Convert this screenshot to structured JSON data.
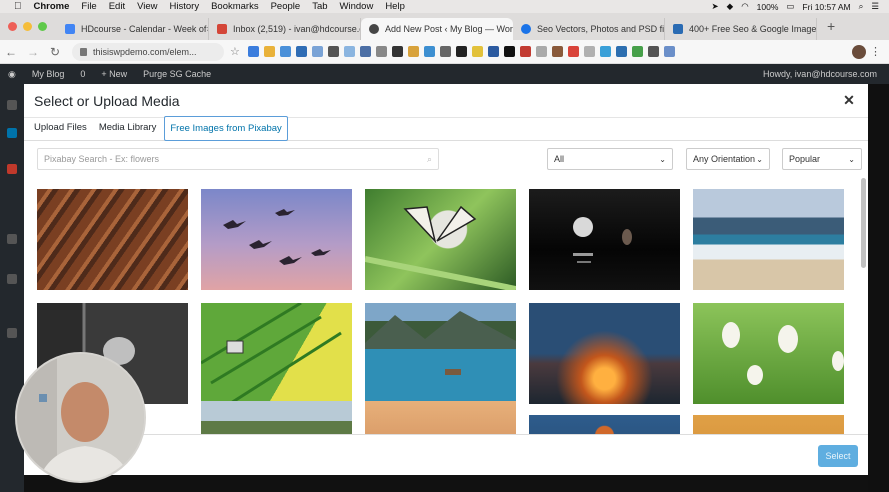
{
  "macbar": {
    "menus": [
      "Chrome",
      "File",
      "Edit",
      "View",
      "History",
      "Bookmarks",
      "People",
      "Tab",
      "Window",
      "Help"
    ],
    "battery": "100%",
    "clock": "Fri 10:57 AM"
  },
  "tabs": [
    {
      "title": "HDcourse - Calendar - Week of",
      "fav_color": "#4285f4",
      "active": false
    },
    {
      "title": "Inbox (2,519) - ivan@hdcourse.c",
      "fav_color": "#d44638",
      "active": false
    },
    {
      "title": "Add New Post ‹ My Blog — Wor",
      "fav_color": "#464646",
      "active": true
    },
    {
      "title": "Seo Vectors, Photos and PSD fil",
      "fav_color": "#1a73e8",
      "active": false
    },
    {
      "title": "400+ Free Seo & Google Image",
      "fav_color": "#2a6bb3",
      "active": false
    }
  ],
  "address": {
    "url": "thisiswpdemo.com/elem..."
  },
  "admin_bar": {
    "site": "My Blog",
    "count": "0",
    "new": "+ New",
    "purge": "Purge SG Cache",
    "howdy": "Howdy, ivan@hdcourse.com"
  },
  "modal": {
    "title": "Select or Upload Media",
    "tabs": [
      "Upload Files",
      "Media Library",
      "Free Images from Pixabay"
    ],
    "search_placeholder": "Pixabay Search - Ex: flowers",
    "filter_type": "All",
    "filter_orientation": "Any Orientation",
    "filter_sort": "Popular",
    "select_button": "Select"
  },
  "images": [
    {
      "name": "tree-roots-image"
    },
    {
      "name": "flying-geese-image"
    },
    {
      "name": "butterfly-image"
    },
    {
      "name": "moon-night-sea-image"
    },
    {
      "name": "ocean-waves-image"
    },
    {
      "name": "cat-bw-image"
    },
    {
      "name": "tractor-field-image"
    },
    {
      "name": "mountain-lake-image"
    },
    {
      "name": "sunset-water-image"
    },
    {
      "name": "white-crocus-image"
    },
    {
      "name": "mountain-valley-image"
    },
    {
      "name": "desert-sunset-image"
    },
    {
      "name": "fox-image"
    },
    {
      "name": "elephant-image"
    }
  ]
}
